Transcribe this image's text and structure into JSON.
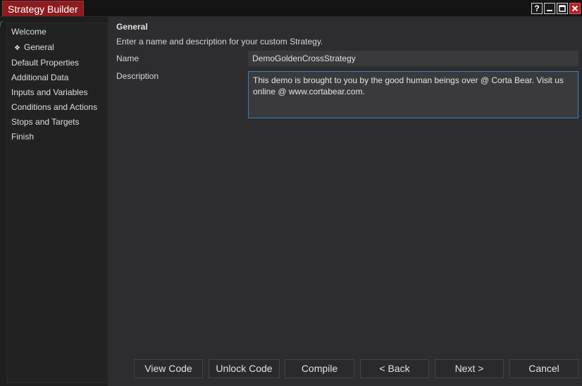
{
  "window": {
    "title": "Strategy Builder",
    "controls": {
      "help": "?",
      "minimize_icon": "minimize-icon",
      "maximize_icon": "maximize-icon",
      "close_icon": "close-icon"
    }
  },
  "sidebar": {
    "items": [
      {
        "label": "Welcome"
      },
      {
        "label": "General",
        "selected": true,
        "icon": "diamond-icon"
      },
      {
        "label": "Default Properties"
      },
      {
        "label": "Additional Data"
      },
      {
        "label": "Inputs and Variables"
      },
      {
        "label": "Conditions and Actions"
      },
      {
        "label": "Stops and Targets"
      },
      {
        "label": "Finish"
      }
    ]
  },
  "main": {
    "section_title": "General",
    "subtitle": "Enter a name and description for your custom Strategy.",
    "name_label": "Name",
    "name_value": "DemoGoldenCrossStrategy",
    "description_label": "Description",
    "description_value": "This demo is brought to you by the good human beings over @ Corta Bear. Visit us online @ www.cortabear.com."
  },
  "buttons": {
    "view_code": "View Code",
    "unlock_code": "Unlock Code",
    "compile": "Compile",
    "back": "< Back",
    "next": "Next >",
    "cancel": "Cancel"
  },
  "colors": {
    "title_accent": "#8c1c1f",
    "focus_border": "#2f80c8",
    "background": "#2d2d2f"
  }
}
